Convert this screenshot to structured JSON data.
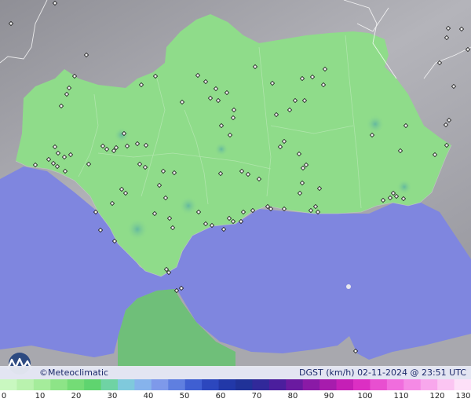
{
  "brand": {
    "name": "Meteoclimatic",
    "copyright_symbol": "©"
  },
  "header": {
    "variable": "DGST (km/h)",
    "timestamp": "02-11-2024 @ 23:51 UTC"
  },
  "legend": {
    "units_variable": "DGST (km/h)",
    "ticks": [
      "0",
      "10",
      "20",
      "30",
      "40",
      "50",
      "60",
      "70",
      "80",
      "90",
      "100",
      "110",
      "120",
      "130"
    ],
    "colors": [
      "#c9f8c0",
      "#b9f2ae",
      "#a5ec9b",
      "#8de487",
      "#74dc76",
      "#5fd46f",
      "#6fd3a4",
      "#7fc9dc",
      "#86b3ec",
      "#7e99ea",
      "#5f7fe0",
      "#3f5fd2",
      "#2c47be",
      "#2238a8",
      "#203298",
      "#31299a",
      "#4b1e9d",
      "#6a1aa0",
      "#8a1aa6",
      "#a71cad",
      "#c51fb6",
      "#dc2fc3",
      "#e84fd0",
      "#f06ddd",
      "#f58ae5",
      "#f8a7ec",
      "#fbc5f2",
      "#fde0f8"
    ]
  },
  "map": {
    "sea_color": "#7f86df",
    "land_color": "#8fdc8a",
    "outside_region_color": "#a9a9b0",
    "station_count": 120
  }
}
